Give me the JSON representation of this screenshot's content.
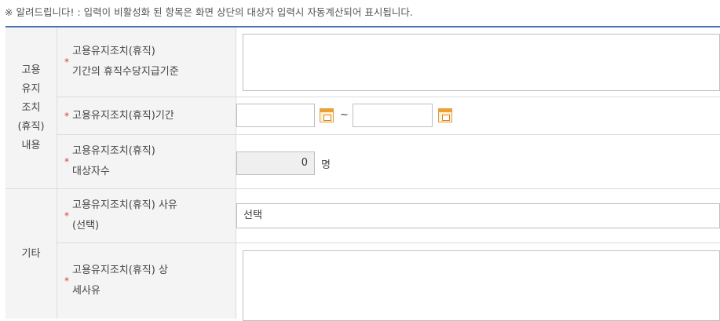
{
  "notice": "※ 알려드립니다! : 입력이 비활성화 된 항목은 화면 상단의 대상자 입력시 자동계산되어 표시됩니다.",
  "sections": {
    "employment": "고용\n유지\n조치\n(휴직)\n내용",
    "other": "기타"
  },
  "fields": {
    "allowance_criteria": {
      "label": "고용유지조치(휴직)\n기간의 휴직수당지급기준",
      "value": ""
    },
    "period": {
      "label": "고용유지조치(휴직)기간",
      "start": "",
      "end": "",
      "separator": "~"
    },
    "target_count": {
      "label": "고용유지조치(휴직)\n대상자수",
      "value": "0",
      "unit": "명"
    },
    "reason": {
      "label": "고용유지조치(휴직) 사유\n(선택)",
      "selected": "선택"
    },
    "detail_reason": {
      "label": "고용유지조치(휴직) 상\n세사유",
      "value": ""
    }
  },
  "required_mark": "*",
  "colors": {
    "required": "#e03a3a",
    "header_border": "#4a6fae",
    "label_bg": "#f4f4f4"
  }
}
